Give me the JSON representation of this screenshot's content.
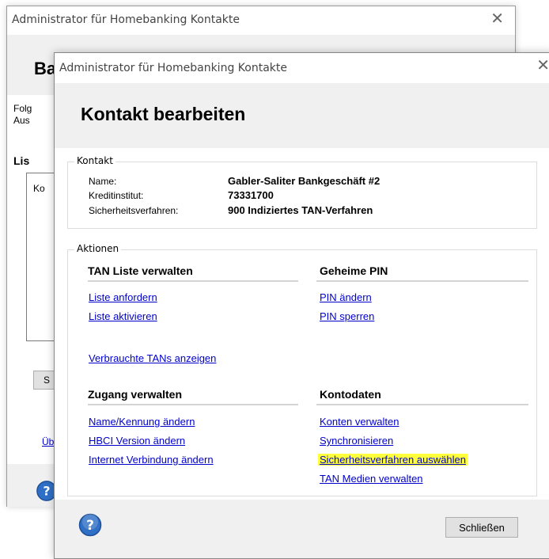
{
  "back_window": {
    "title": "Administrator für Homebanking Kontakte",
    "header_partial": "Ba",
    "text_line1": "Folg",
    "text_line2": "Aus",
    "section_partial": "Lis",
    "list_col_partial": "Ko",
    "button_partial": "S",
    "link_partial": "Üb"
  },
  "window": {
    "title": "Administrator für Homebanking Kontakte",
    "page_title": "Kontakt bearbeiten"
  },
  "kontakt": {
    "legend": "Kontakt",
    "name_label": "Name:",
    "name_value": "Gabler-Saliter Bankgeschäft #2",
    "bank_label": "Kreditinstitut:",
    "bank_value": "73331700",
    "security_label": "Sicherheitsverfahren:",
    "security_value": "900 Indiziertes TAN-Verfahren"
  },
  "aktionen": {
    "legend": "Aktionen",
    "tan": {
      "title": "TAN Liste verwalten",
      "request": "Liste anfordern",
      "activate": "Liste aktivieren",
      "used": "Verbrauchte TANs anzeigen"
    },
    "pin": {
      "title": "Geheime PIN",
      "change": "PIN ändern",
      "lock": "PIN sperren"
    },
    "access": {
      "title": "Zugang verwalten",
      "name": "Name/Kennung ändern",
      "hbci": "HBCI Version ändern",
      "internet": "Internet Verbindung ändern"
    },
    "accounts": {
      "title": "Kontodaten",
      "manage": "Konten verwalten",
      "sync": "Synchronisieren",
      "security": "Sicherheitsverfahren auswählen",
      "tan_media": "TAN Medien verwalten"
    }
  },
  "footer": {
    "close_label": "Schließen"
  },
  "colors": {
    "link": "#0000cc",
    "highlight": "#ffff3b",
    "help_icon": "#2f6fc5"
  }
}
